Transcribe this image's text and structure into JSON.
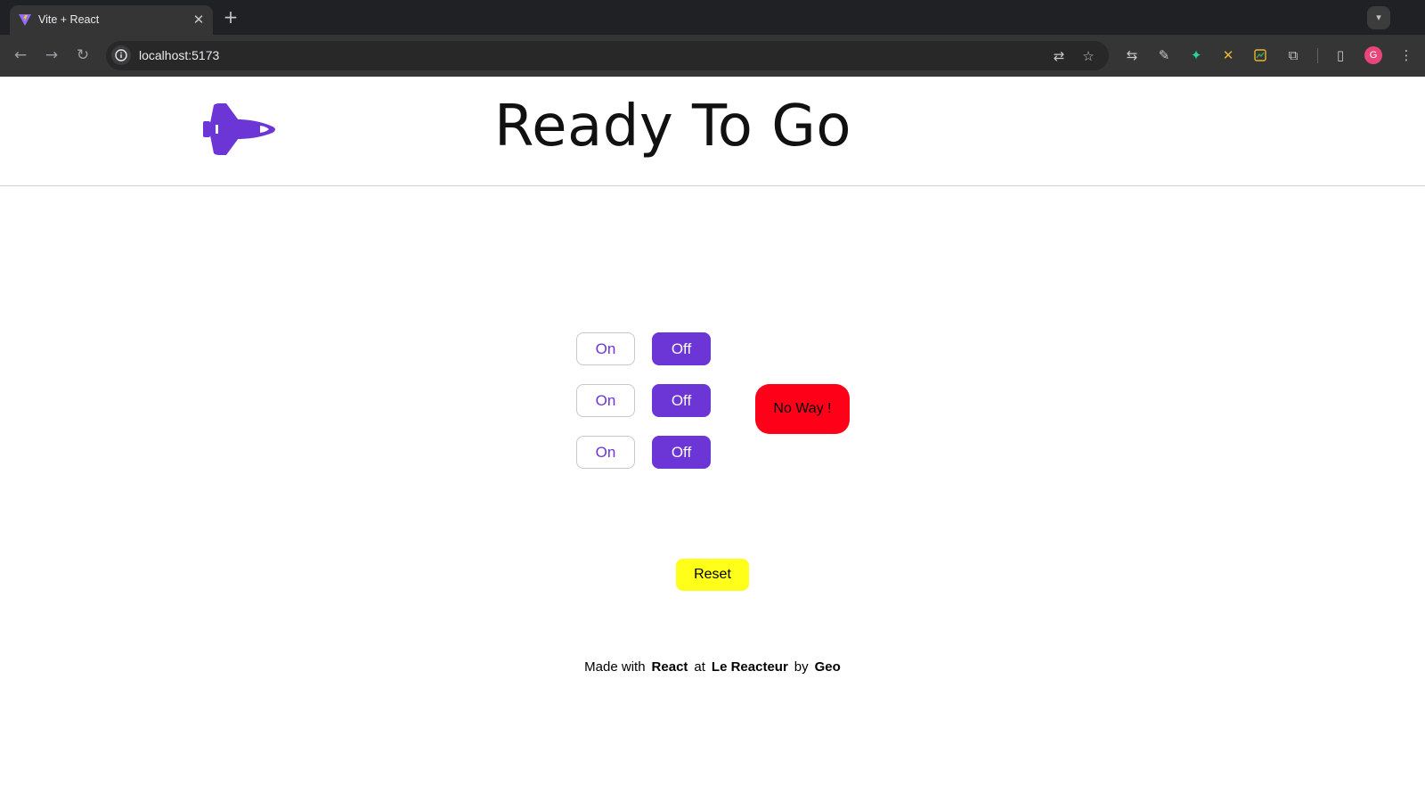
{
  "browser": {
    "tab_title": "Vite + React",
    "tab_close_icon": "close-icon",
    "new_tab_icon": "plus-icon",
    "url": "localhost:5173",
    "avatar_initial": "G"
  },
  "app": {
    "title": "Ready To Go",
    "logo_icon": "space-shuttle-icon",
    "accent_color": "#6c35d6",
    "switches": [
      {
        "on_label": "On",
        "off_label": "Off",
        "state": "off"
      },
      {
        "on_label": "On",
        "off_label": "Off",
        "state": "off"
      },
      {
        "on_label": "On",
        "off_label": "Off",
        "state": "off"
      }
    ],
    "status_label": "No Way !",
    "status_color": "#ff0019",
    "reset_label": "Reset",
    "reset_color": "#ffff1a"
  },
  "footer": {
    "made_with": "Made with",
    "tech": "React",
    "at": "at",
    "school": "Le Reacteur",
    "by": "by",
    "author": "Geo"
  }
}
